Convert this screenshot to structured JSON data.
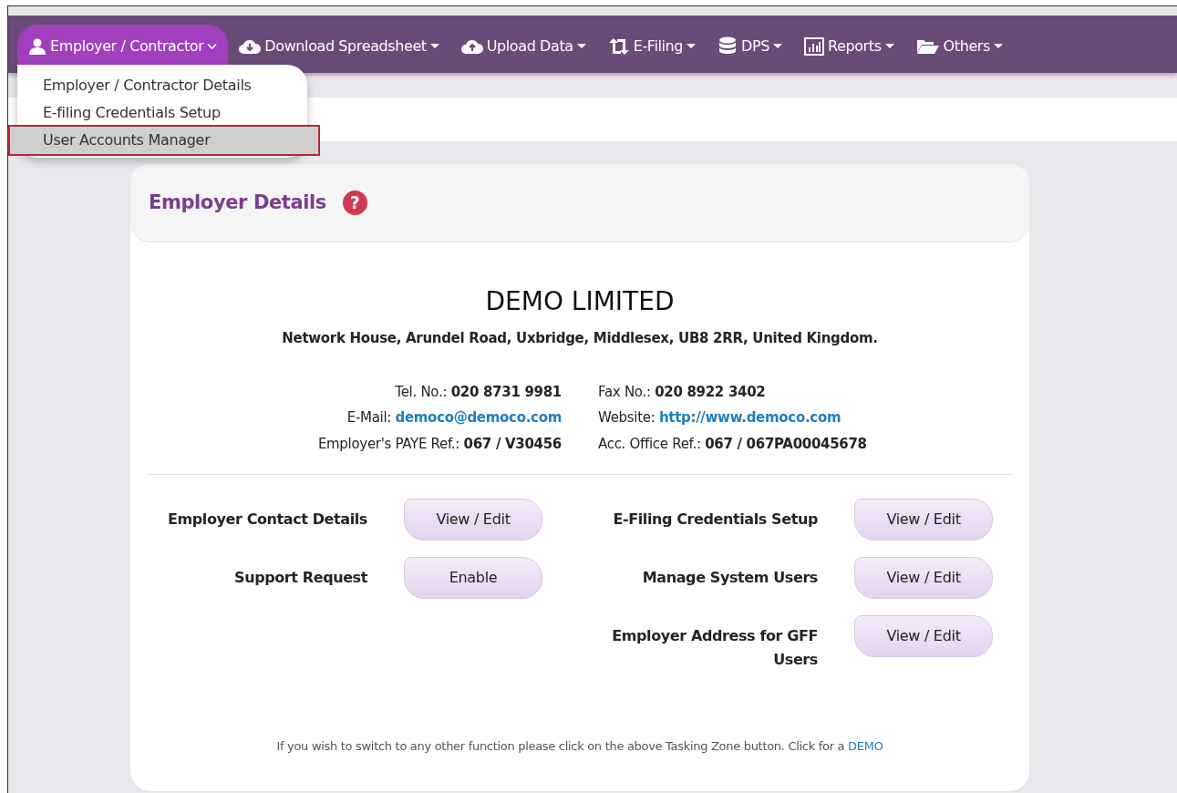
{
  "nav": [
    {
      "label": "Employer / Contractor",
      "selected": true
    },
    {
      "label": "Download Spreadsheet",
      "selected": false
    },
    {
      "label": "Upload Data",
      "selected": false
    },
    {
      "label": "E-Filing",
      "selected": false
    },
    {
      "label": "DPS",
      "selected": false
    },
    {
      "label": "Reports",
      "selected": false
    },
    {
      "label": "Others",
      "selected": false
    }
  ],
  "dropdown": [
    {
      "label": "Employer / Contractor Details",
      "selected": false
    },
    {
      "label": "E-filing Credentials Setup",
      "selected": false
    },
    {
      "label": "User Accounts Manager",
      "selected": true
    }
  ],
  "card": {
    "title": "Employer Details",
    "help": "?",
    "company": "DEMO LIMITED",
    "address": "Network House, Arundel Road, Uxbridge, Middlesex, UB8 2RR, United Kingdom.",
    "info": [
      [
        {
          "label": "Tel. No.:",
          "value": "020 8731 9981",
          "kind": "text"
        },
        {
          "label": "Fax No.:",
          "value": "020 8922 3402",
          "kind": "text"
        }
      ],
      [
        {
          "label": "E-Mail:",
          "value": "democo@democo.com",
          "kind": "link"
        },
        {
          "label": "Website:",
          "value": "http://www.democo.com",
          "kind": "link"
        }
      ],
      [
        {
          "label": "Employer's PAYE Ref.:",
          "value": "067 / V30456",
          "kind": "text"
        },
        {
          "label": "Acc. Office Ref.:",
          "value": "067 / 067PA00045678",
          "kind": "text"
        }
      ]
    ],
    "actions_left": [
      {
        "label": "Employer Contact Details",
        "button": "View / Edit"
      },
      {
        "label": "Support Request",
        "button": "Enable"
      }
    ],
    "actions_right": [
      {
        "label": "E-Filing Credentials Setup",
        "button": "View / Edit"
      },
      {
        "label": "Manage System Users",
        "button": "View / Edit"
      },
      {
        "label": "Employer Address for GFF Users",
        "button": "View / Edit"
      }
    ],
    "footer": {
      "text": "If you wish to switch to any other function please click on the above Tasking Zone button. Click for a",
      "link": "DEMO"
    }
  }
}
